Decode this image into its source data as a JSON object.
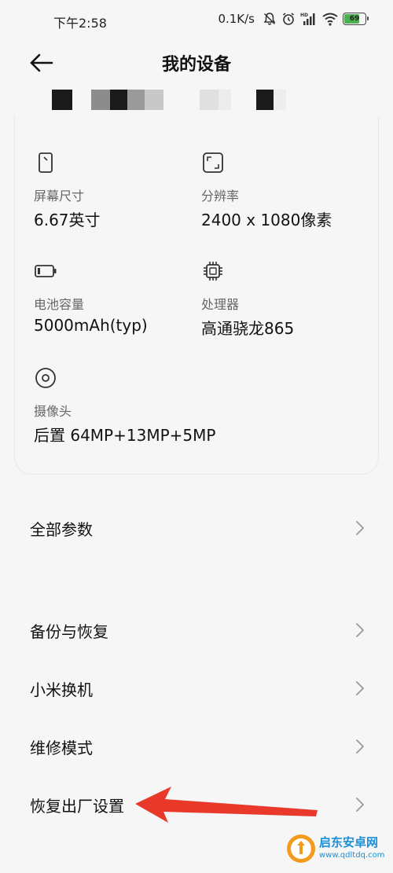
{
  "status_bar": {
    "time": "下午2:58",
    "network_speed": "0.1K/s",
    "battery_level": "69",
    "battery_percent": 0.69,
    "icons": [
      "bell-muted-icon",
      "alarm-icon",
      "hd-signal-icon",
      "wifi-icon",
      "battery-icon"
    ]
  },
  "header": {
    "title": "我的设备",
    "back_icon": "arrow-left-icon"
  },
  "specs": [
    {
      "icon": "screen-size-icon",
      "label": "屏幕尺寸",
      "value": "6.67英寸"
    },
    {
      "icon": "resolution-icon",
      "label": "分辨率",
      "value": "2400 x 1080像素"
    },
    {
      "icon": "battery-capacity-icon",
      "label": "电池容量",
      "value": "5000mAh(typ)"
    },
    {
      "icon": "processor-chip-icon",
      "label": "处理器",
      "value": "高通骁龙865"
    },
    {
      "icon": "camera-lens-icon",
      "label": "摄像头",
      "value": "后置 64MP+13MP+5MP"
    }
  ],
  "menu": [
    {
      "label": "全部参数"
    },
    {
      "label": "备份与恢复"
    },
    {
      "label": "小米换机"
    },
    {
      "label": "维修模式"
    },
    {
      "label": "恢复出厂设置"
    }
  ],
  "annotation": {
    "color": "#e8392b",
    "target": "恢复出厂设置"
  },
  "watermark": {
    "title": "启东安卓网",
    "url": "www.qdltdq.com",
    "color": "#1c8fd6",
    "logo_color": "#f29b1d"
  }
}
